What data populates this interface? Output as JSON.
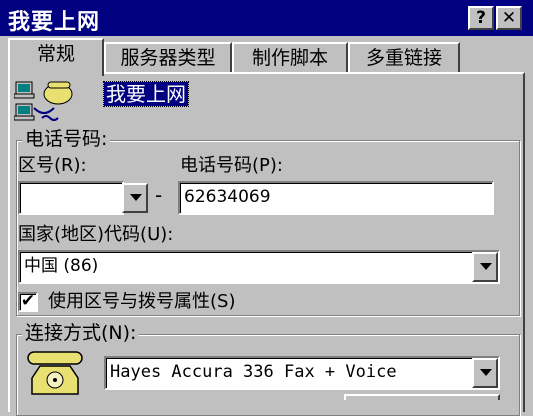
{
  "window": {
    "title": "我要上网",
    "help_button": "?",
    "close_button": "✕"
  },
  "tabs": [
    {
      "label": "常规"
    },
    {
      "label": "服务器类型"
    },
    {
      "label": "制作脚本"
    },
    {
      "label": "多重链接"
    }
  ],
  "general": {
    "connection_name": "我要上网",
    "phone_group": {
      "legend": "电话号码:",
      "area_code_label": "区号(R):",
      "area_code_value": "",
      "dash": "-",
      "phone_label": "电话号码(P):",
      "phone_value": "62634069",
      "country_label": "国家(地区)代码(U):",
      "country_value": "中国 (86)",
      "use_area_checkbox_checked": true,
      "use_area_label": "使用区号与拨号属性(S)"
    },
    "connect_group": {
      "legend": "连接方式(N):",
      "modem_value": "Hayes Accura 336 Fax + Voice"
    }
  },
  "icons": {
    "connection_icon": "dial-up-network-icon",
    "modem_icon": "telephone-icon"
  }
}
